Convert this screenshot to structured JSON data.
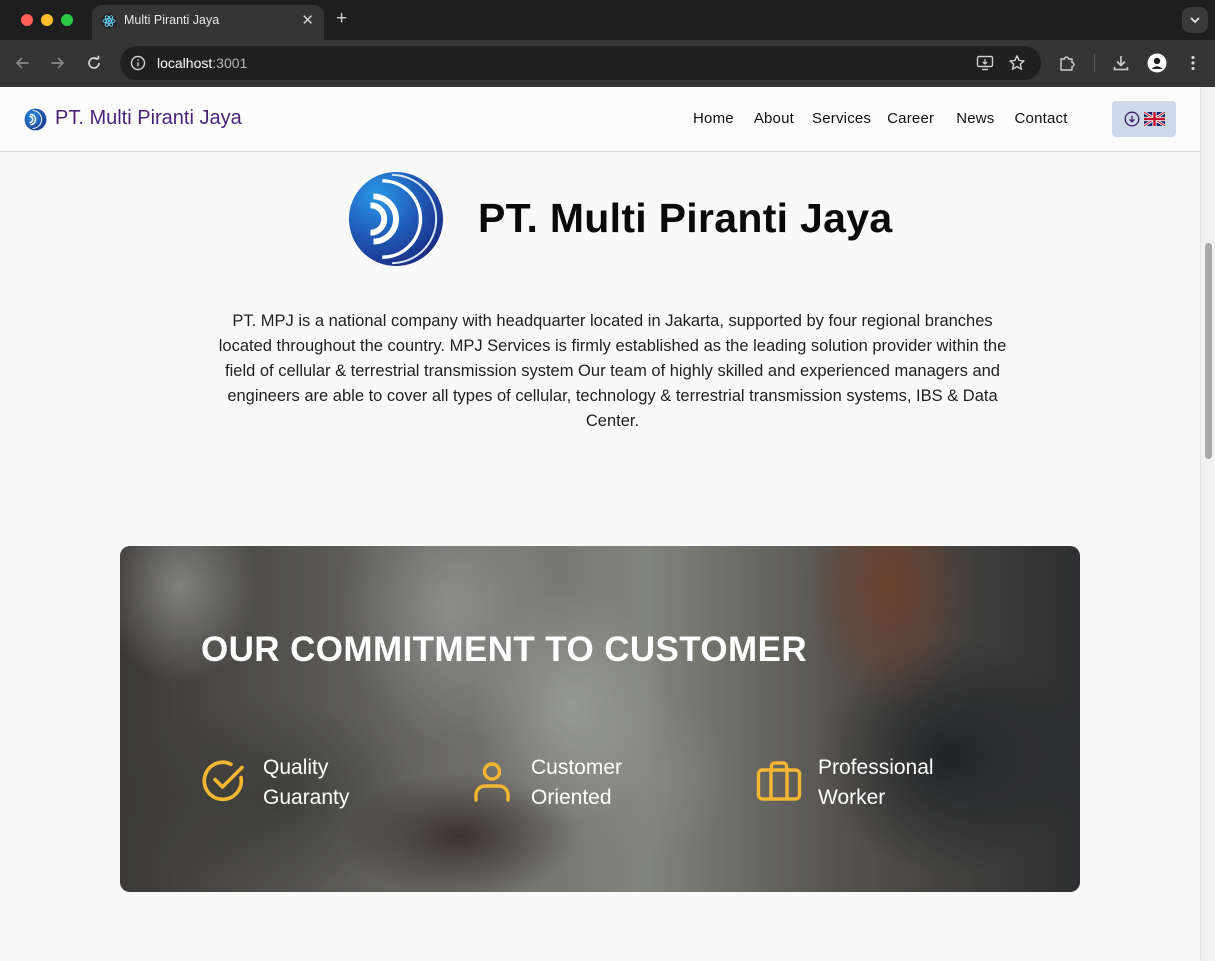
{
  "browser": {
    "tab_title": "Multi Piranti Jaya",
    "url_host": "localhost",
    "url_port": ":3001"
  },
  "navbar": {
    "brand": "PT. Multi Piranti Jaya",
    "links": [
      "Home",
      "About",
      "Services",
      "Career",
      "News",
      "Contact"
    ]
  },
  "hero": {
    "title": "PT. Multi Piranti Jaya",
    "description": "PT. MPJ is a national company with headquarter located in Jakarta, supported by four regional branches located throughout the country. MPJ Services is firmly established as the leading solution provider within the field of cellular & terrestrial transmission system Our team of highly skilled and experienced managers and engineers are able to cover all types of cellular, technology & terrestrial transmission systems, IBS & Data Center."
  },
  "commitment": {
    "title": "OUR COMMITMENT TO CUSTOMER",
    "features": [
      {
        "label": "Quality\nGuaranty",
        "icon": "check-circle-icon"
      },
      {
        "label": "Customer\nOriented",
        "icon": "user-icon"
      },
      {
        "label": "Professional\nWorker",
        "icon": "briefcase-icon"
      }
    ]
  },
  "colors": {
    "brand_purple": "#4a2378",
    "accent_yellow": "#f5b731",
    "lang_button_bg": "#cdd9e8"
  }
}
